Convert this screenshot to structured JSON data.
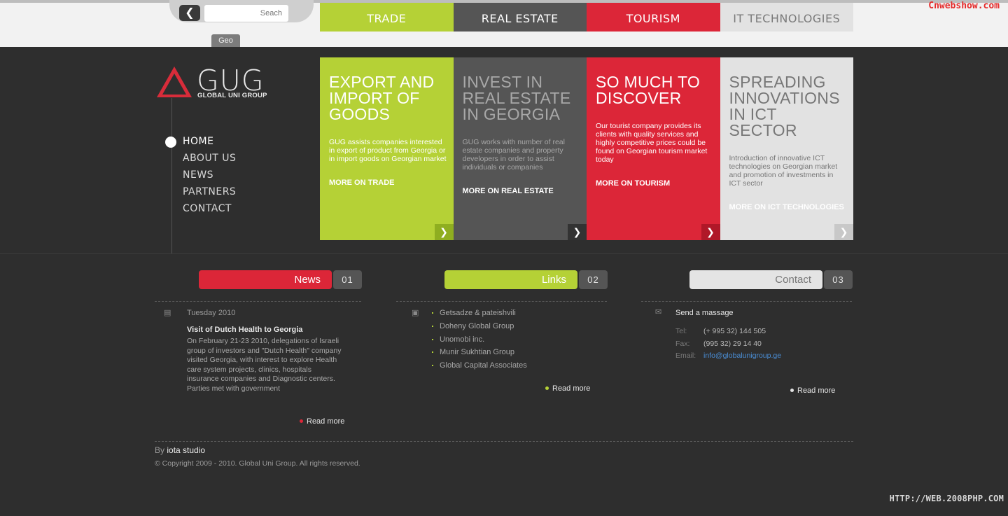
{
  "brandmark": "Cnwebshow.com",
  "search": {
    "placeholder": "Seach",
    "back_icon": "chevron-left-icon"
  },
  "language": "Geo",
  "topnav": [
    {
      "label": "TRADE",
      "bg": "#b5d136",
      "fg": "#ffffff"
    },
    {
      "label": "REAL ESTATE",
      "bg": "#555555",
      "fg": "#ffffff"
    },
    {
      "label": "TOURISM",
      "bg": "#dc2638",
      "fg": "#ffffff"
    },
    {
      "label": "IT TECHNOLOGIES",
      "bg": "#e2e2e2",
      "fg": "#7a7a7a"
    }
  ],
  "logo": {
    "main": "GUG",
    "sub": "GLOBAL UNI GROUP",
    "color": "#d82c3a"
  },
  "sidenav": [
    "HOME",
    "ABOUT US",
    "NEWS",
    "PARTNERS",
    "CONTACT"
  ],
  "panels": [
    {
      "title": "EXPORT AND IMPORT OF GOODS",
      "text": "GUG assists companies interested in export of product from Georgia or in import goods on Georgian market",
      "more": "MORE ON TRADE",
      "bg": "#b5d136",
      "title_color": "#ffffff",
      "text_color": "#ffffff",
      "more_color": "#ffffff",
      "arrow_bg": "#8fae20"
    },
    {
      "title": "INVEST IN REAL ESTATE IN GEORGIA",
      "text": "GUG works with number of real estate companies and property developers in order to assist individuals or companies",
      "more": "MORE ON REAL ESTATE",
      "bg": "#555555",
      "title_color": "#a8a8a8",
      "text_color": "#a8a8a8",
      "more_color": "#ffffff",
      "arrow_bg": "#333333"
    },
    {
      "title": "SO MUCH TO DISCOVER",
      "text": "Our tourist company provides its clients with quality services and highly competitive prices could be found on Georgian tourism market today",
      "more": "MORE ON TOURISM",
      "bg": "#dc2638",
      "title_color": "#ffffff",
      "text_color": "#ffffff",
      "more_color": "#ffffff",
      "arrow_bg": "#b01828"
    },
    {
      "title": "SPREADING INNOVATIONS IN ICT SECTOR",
      "text": "Introduction of innovative ICT technologies on Georgian market and promotion of investments in ICT sector",
      "more": "MORE ON ICT TECHNOLOGIES",
      "bg": "#e2e2e2",
      "title_color": "#777777",
      "text_color": "#777777",
      "more_color": "#ffffff",
      "arrow_bg": "#c8c8c8"
    }
  ],
  "news": {
    "heading": "News",
    "num": "01",
    "color": "#dc2638",
    "date": "Tuesday 2010",
    "title": "Visit of Dutch Health to Georgia",
    "body": "On February 21-23 2010, delegations of Israeli group of investors and \"Dutch Health\" company visited Georgia, with interest to explore Health care system projects, clinics, hospitals insurance companies and Diagnostic centers. Parties met with government",
    "readmore": "Read more"
  },
  "links": {
    "heading": "Links",
    "num": "02",
    "color": "#b5d136",
    "items": [
      "Getsadze & pateishvili",
      "Doheny Global Group",
      "Unomobi inc.",
      "Munir Sukhtian Group",
      "Global Capital Associates"
    ],
    "readmore": "Read more"
  },
  "contact": {
    "heading": "Contact",
    "num": "03",
    "color": "#e4e4e4",
    "title": "Send a massage",
    "tel_label": "Tel:",
    "tel": "(+ 995 32) 144 505",
    "fax_label": "Fax:",
    "fax": "(995 32) 29 14 40",
    "email_label": "Email:",
    "email": "info@globalunigroup.ge",
    "readmore": "Read more"
  },
  "footer": {
    "by": "By",
    "studio": "iota studio",
    "copyright": "© Copyright 2009 - 2010. Global Uni Group. All rights reserved."
  },
  "watermark": "HTTP://WEB.2008PHP.COM"
}
